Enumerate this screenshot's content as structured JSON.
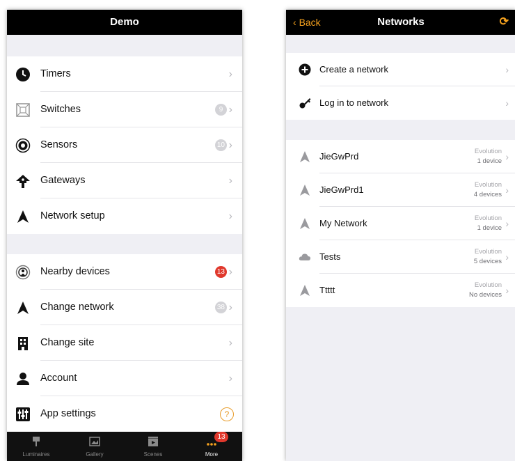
{
  "left": {
    "title": "Demo",
    "menu1": [
      {
        "label": "Timers",
        "icon": "clock-icon"
      },
      {
        "label": "Switches",
        "icon": "switch-icon",
        "badge": "9"
      },
      {
        "label": "Sensors",
        "icon": "sensor-icon",
        "badge": "10"
      },
      {
        "label": "Gateways",
        "icon": "gateway-icon"
      },
      {
        "label": "Network setup",
        "icon": "network-icon"
      }
    ],
    "menu2": [
      {
        "label": "Nearby devices",
        "icon": "nearby-icon",
        "badge": "13",
        "badge_color": "#e0382c"
      },
      {
        "label": "Change network",
        "icon": "network-icon",
        "badge": "38"
      },
      {
        "label": "Change site",
        "icon": "building-icon"
      },
      {
        "label": "Account",
        "icon": "account-icon"
      },
      {
        "label": "App settings",
        "icon": "settings-icon",
        "help": "?"
      }
    ],
    "tabs": [
      {
        "label": "Luminaires",
        "icon": "luminaire-icon"
      },
      {
        "label": "Gallery",
        "icon": "gallery-icon"
      },
      {
        "label": "Scenes",
        "icon": "scenes-icon"
      },
      {
        "label": "More",
        "icon": "more-icon",
        "badge": "13",
        "active": true
      }
    ]
  },
  "right": {
    "back_label": "Back",
    "title": "Networks",
    "refresh_icon": "refresh-icon",
    "actions": [
      {
        "label": "Create a network",
        "icon": "add-icon"
      },
      {
        "label": "Log in to network",
        "icon": "key-icon"
      }
    ],
    "networks": [
      {
        "name": "JieGwPrd",
        "kind": "Evolution",
        "devices": "1 device",
        "icon": "network-icon"
      },
      {
        "name": "JieGwPrd1",
        "kind": "Evolution",
        "devices": "4 devices",
        "icon": "network-icon"
      },
      {
        "name": "My Network",
        "kind": "Evolution",
        "devices": "1 device",
        "icon": "network-icon"
      },
      {
        "name": "Tests",
        "kind": "Evolution",
        "devices": "5 devices",
        "icon": "cloud-icon"
      },
      {
        "name": "Ttttt",
        "kind": "Evolution",
        "devices": "No devices",
        "icon": "network-icon"
      }
    ]
  },
  "colors": {
    "accent": "#f6a21e",
    "badge_red": "#e0382c",
    "badge_gray": "#d3d3d7",
    "background": "#efeff4"
  }
}
